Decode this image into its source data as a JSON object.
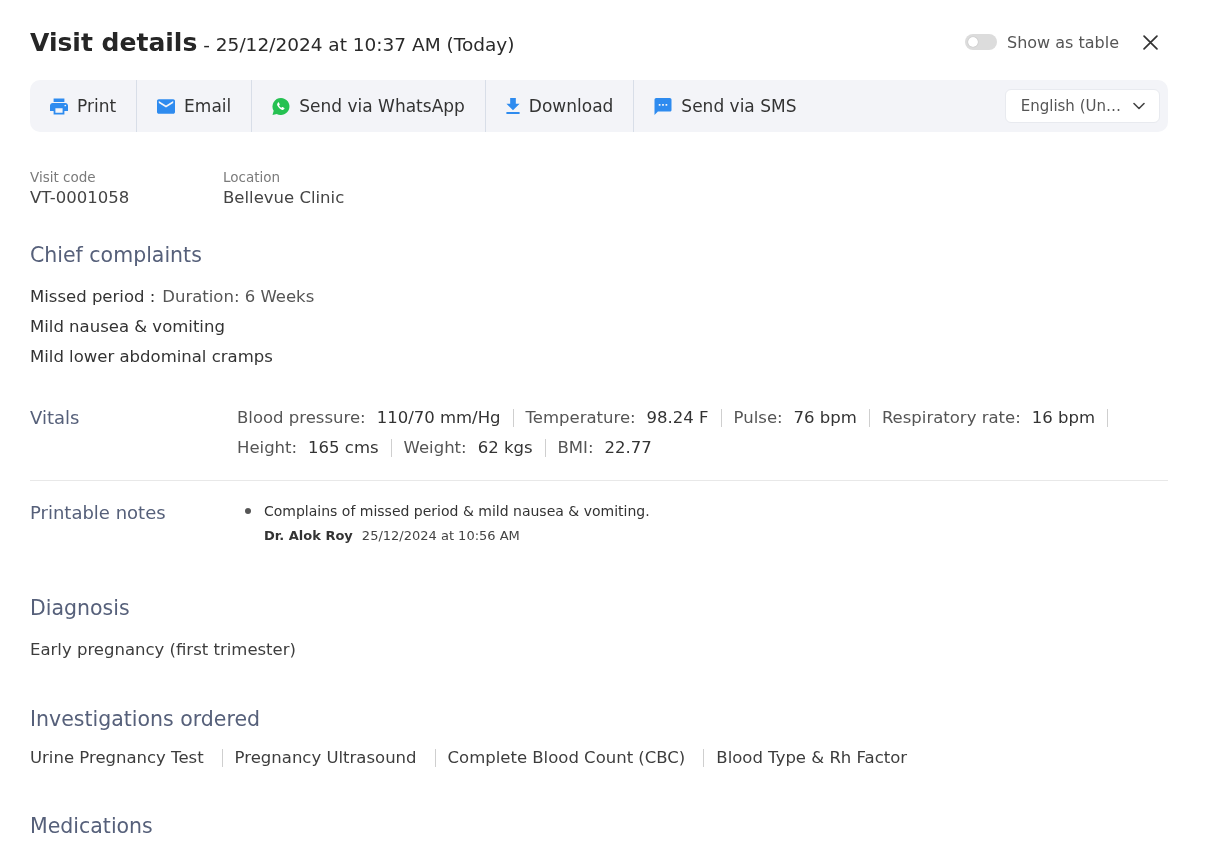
{
  "header": {
    "title": "Visit details",
    "subtitle": "- 25/12/2024 at 10:37 AM (Today)",
    "toggle": {
      "label": "Show as table",
      "on": false
    }
  },
  "toolbar": {
    "actions": [
      {
        "kind": "print",
        "label": "Print"
      },
      {
        "kind": "email",
        "label": "Email"
      },
      {
        "kind": "whatsapp",
        "label": "Send via WhatsApp"
      },
      {
        "kind": "download",
        "label": "Download"
      },
      {
        "kind": "sms",
        "label": "Send via SMS"
      }
    ],
    "language": {
      "value": "English (Un…"
    }
  },
  "visit_info": [
    {
      "label": "Visit code",
      "value": "VT-0001058"
    },
    {
      "label": "Location",
      "value": "Bellevue Clinic"
    }
  ],
  "chief_complaints": {
    "heading": "Chief complaints",
    "items": [
      {
        "name": "Missed period :",
        "detail": "Duration: 6 Weeks"
      },
      {
        "name": "Mild nausea & vomiting"
      },
      {
        "name": "Mild lower abdominal cramps"
      }
    ]
  },
  "vitals": {
    "heading": "Vitals",
    "items": [
      {
        "label": "Blood pressure:",
        "value": "110/70 mm/Hg"
      },
      {
        "label": "Temperature:",
        "value": "98.24 F"
      },
      {
        "label": "Pulse:",
        "value": "76 bpm"
      },
      {
        "label": "Respiratory rate:",
        "value": "16 bpm"
      },
      {
        "label": "Height:",
        "value": "165 cms"
      },
      {
        "label": "Weight:",
        "value": "62 kgs"
      },
      {
        "label": "BMI:",
        "value": "22.77"
      }
    ]
  },
  "printable_notes": {
    "heading": "Printable notes",
    "notes": [
      {
        "text": "Complains of missed period & mild nausea & vomiting.",
        "author": "Dr. Alok Roy",
        "time": "25/12/2024 at 10:56 AM"
      }
    ]
  },
  "diagnosis": {
    "heading": "Diagnosis",
    "items": [
      "Early pregnancy (first trimester)"
    ]
  },
  "investigations": {
    "heading": "Investigations ordered",
    "items": [
      "Urine Pregnancy Test",
      "Pregnancy Ultrasound",
      "Complete Blood Count (CBC)",
      "Blood Type & Rh Factor"
    ]
  },
  "medications": {
    "heading": "Medications"
  }
}
